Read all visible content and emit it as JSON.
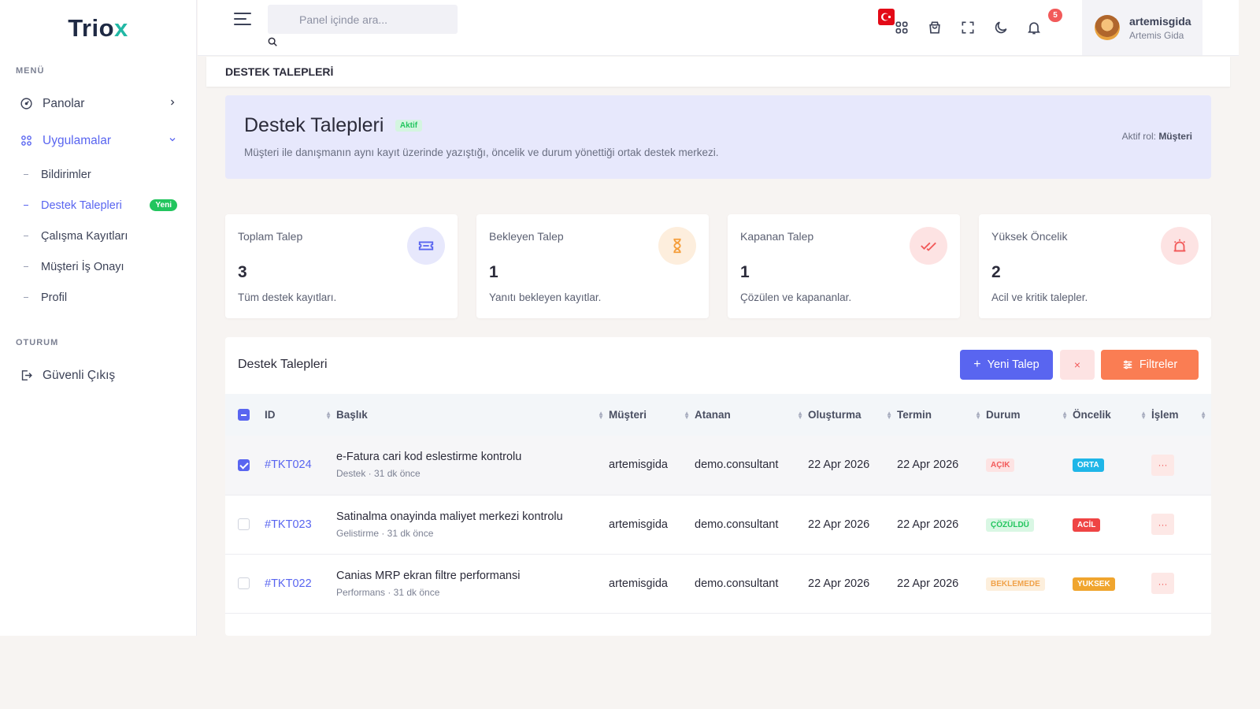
{
  "brand": {
    "name_main": "Trio",
    "name_accent": "x"
  },
  "sidebar": {
    "menu_title": "MENÜ",
    "items": [
      {
        "label": "Panolar",
        "icon": "gauge-icon"
      },
      {
        "label": "Uygulamalar",
        "icon": "apps-icon"
      }
    ],
    "sub_items": [
      {
        "label": "Bildirimler"
      },
      {
        "label": "Destek Talepleri",
        "badge": "Yeni"
      },
      {
        "label": "Çalışma Kayıtları"
      },
      {
        "label": "Müşteri İş Onayı"
      },
      {
        "label": "Profil"
      }
    ],
    "session_title": "OTURUM",
    "logout_label": "Güvenli Çıkış"
  },
  "header": {
    "search_placeholder": "Panel içinde ara...",
    "notification_count": "5",
    "user_name": "artemisgida",
    "user_company": "Artemis Gida"
  },
  "breadcrumb": "DESTEK TALEPLERİ",
  "hero": {
    "title": "Destek Talepleri",
    "badge": "Aktif",
    "description": "Müşteri ile danışmanın aynı kayıt üzerinde yazıştığı, öncelik ve durum yönettiği ortak destek merkezi.",
    "role_label": "Aktif rol:",
    "role_value": "Müşteri"
  },
  "stats": [
    {
      "label": "Toplam Talep",
      "value": "3",
      "sub": "Tüm destek kayıtları.",
      "icon": "ticket-icon",
      "color": "#5965f0",
      "bg": "#e7e8fc"
    },
    {
      "label": "Bekleyen Talep",
      "value": "1",
      "sub": "Yanıtı bekleyen kayıtlar.",
      "icon": "hourglass-icon",
      "color": "#f59e3b",
      "bg": "#fdeedd"
    },
    {
      "label": "Kapanan Talep",
      "value": "1",
      "sub": "Çözülen ve kapananlar.",
      "icon": "double-check-icon",
      "color": "#f25a5a",
      "bg": "#fde3e3"
    },
    {
      "label": "Yüksek Öncelik",
      "value": "2",
      "sub": "Acil ve kritik talepler.",
      "icon": "alarm-icon",
      "color": "#f25a5a",
      "bg": "#fde3e3"
    }
  ],
  "table": {
    "title": "Destek Talepleri",
    "new_button": "Yeni Talep",
    "clear_button": "×",
    "filter_button": "Filtreler",
    "columns": [
      "ID",
      "Başlık",
      "Müşteri",
      "Atanan",
      "Oluşturma",
      "Termin",
      "Durum",
      "Öncelik",
      "İşlem"
    ],
    "rows": [
      {
        "id": "#TKT024",
        "title": "e-Fatura cari kod eslestirme kontrolu",
        "meta": "Destek · 31 dk önce",
        "customer": "artemisgida",
        "assignee": "demo.consultant",
        "created": "22 Apr 2026",
        "due": "22 Apr 2026",
        "status": "AÇIK",
        "status_fg": "#f25a5a",
        "status_bg": "#fde3e3",
        "priority": "ORTA",
        "priority_bg": "#1fb6e8",
        "selected": true,
        "action": "···"
      },
      {
        "id": "#TKT023",
        "title": "Satinalma onayinda maliyet merkezi kontrolu",
        "meta": "Gelistirme · 31 dk önce",
        "customer": "artemisgida",
        "assignee": "demo.consultant",
        "created": "22 Apr 2026",
        "due": "22 Apr 2026",
        "status": "ÇÖZÜLDÜ",
        "status_fg": "#22c55e",
        "status_bg": "#d9f7e4",
        "priority": "ACİL",
        "priority_bg": "#ef4444",
        "selected": false,
        "action": "···"
      },
      {
        "id": "#TKT022",
        "title": "Canias MRP ekran filtre performansi",
        "meta": "Performans · 31 dk önce",
        "customer": "artemisgida",
        "assignee": "demo.consultant",
        "created": "22 Apr 2026",
        "due": "22 Apr 2026",
        "status": "BEKLEMEDE",
        "status_fg": "#f0a24a",
        "status_bg": "#fdefdc",
        "priority": "YUKSEK",
        "priority_bg": "#f0a52e",
        "selected": false,
        "action": "···"
      }
    ]
  }
}
